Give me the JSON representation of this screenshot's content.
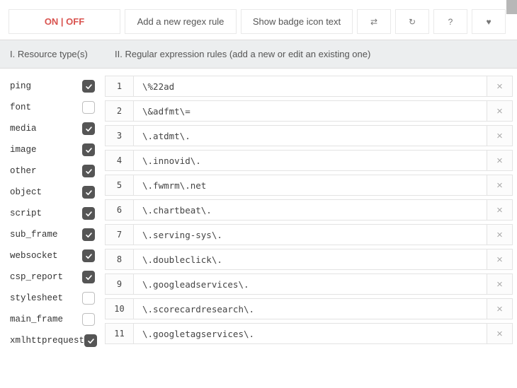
{
  "toolbar": {
    "onoff_label": "ON | OFF",
    "add_rule_label": "Add a new regex rule",
    "badge_label": "Show badge icon text",
    "refresh_tooltip": "Reload",
    "reset_tooltip": "Reset",
    "help_tooltip": "?",
    "favorite_tooltip": "Favorite"
  },
  "sections": {
    "col1_label": "I. Resource type(s)",
    "col2_label": "II. Regular expression rules (add a new or edit an existing one)"
  },
  "resource_types": [
    {
      "name": "ping",
      "checked": true
    },
    {
      "name": "font",
      "checked": false
    },
    {
      "name": "media",
      "checked": true
    },
    {
      "name": "image",
      "checked": true
    },
    {
      "name": "other",
      "checked": true
    },
    {
      "name": "object",
      "checked": true
    },
    {
      "name": "script",
      "checked": true
    },
    {
      "name": "sub_frame",
      "checked": true
    },
    {
      "name": "websocket",
      "checked": true
    },
    {
      "name": "csp_report",
      "checked": true
    },
    {
      "name": "stylesheet",
      "checked": false
    },
    {
      "name": "main_frame",
      "checked": false
    },
    {
      "name": "xmlhttprequest",
      "checked": true
    }
  ],
  "rules": [
    {
      "n": 1,
      "pattern": "\\%22ad"
    },
    {
      "n": 2,
      "pattern": "\\&adfmt\\="
    },
    {
      "n": 3,
      "pattern": "\\.atdmt\\."
    },
    {
      "n": 4,
      "pattern": "\\.innovid\\."
    },
    {
      "n": 5,
      "pattern": "\\.fwmrm\\.net"
    },
    {
      "n": 6,
      "pattern": "\\.chartbeat\\."
    },
    {
      "n": 7,
      "pattern": "\\.serving-sys\\."
    },
    {
      "n": 8,
      "pattern": "\\.doubleclick\\."
    },
    {
      "n": 9,
      "pattern": "\\.googleadservices\\."
    },
    {
      "n": 10,
      "pattern": "\\.scorecardresearch\\."
    },
    {
      "n": 11,
      "pattern": "\\.googletagservices\\."
    }
  ],
  "icons": {
    "refresh": "⇄",
    "reload": "↻",
    "help": "?",
    "heart": "♥",
    "close": "×"
  }
}
